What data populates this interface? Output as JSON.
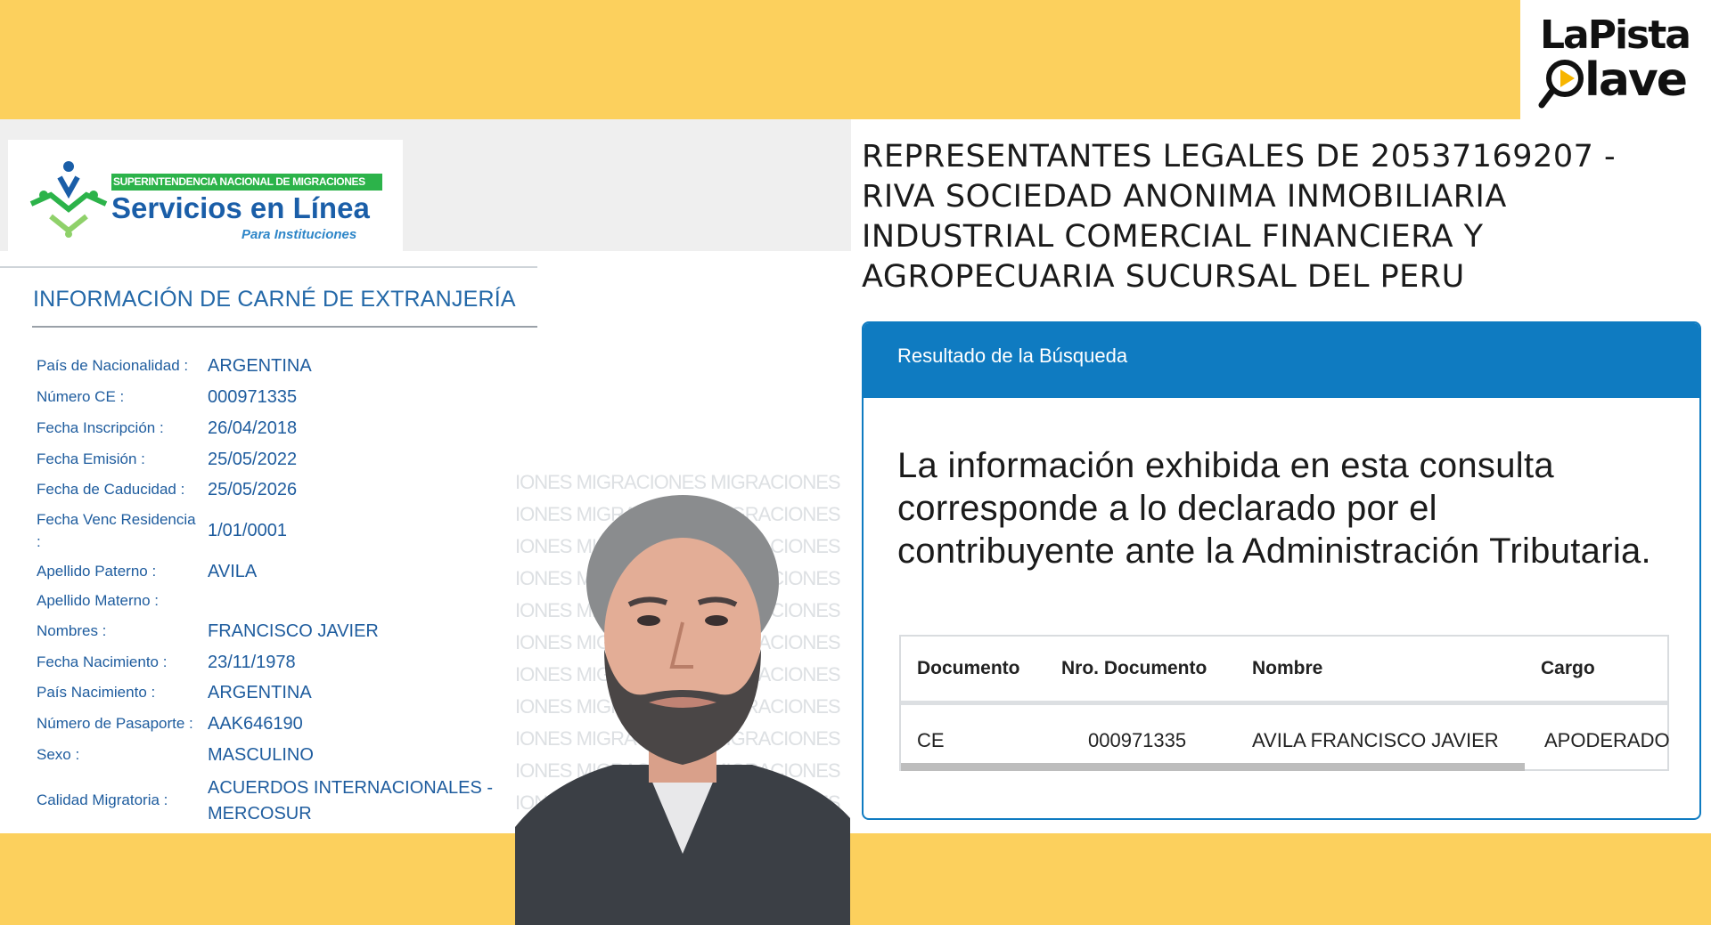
{
  "brand": {
    "line1": "LaPista",
    "line2": "lave"
  },
  "migraciones": {
    "strip": "SUPERINTENDENCIA NACIONAL DE MIGRACIONES",
    "title": "Servicios en Línea",
    "subtitle": "Para Instituciones",
    "section_title": "INFORMACIÓN DE CARNÉ DE EXTRANJERÍA",
    "watermark": "IONES MIGRACIONES MIGRACIONES",
    "fields": [
      {
        "label": "País de Nacionalidad :",
        "value": "ARGENTINA"
      },
      {
        "label": "Número CE :",
        "value": "000971335"
      },
      {
        "label": "Fecha Inscripción :",
        "value": "26/04/2018"
      },
      {
        "label": "Fecha Emisión :",
        "value": "25/05/2022"
      },
      {
        "label": "Fecha de Caducidad :",
        "value": "25/05/2026"
      },
      {
        "label": "Fecha Venc Residencia",
        "label2": ":",
        "value": "1/01/0001"
      },
      {
        "label": "Apellido Paterno :",
        "value": "AVILA"
      },
      {
        "label": "Apellido Materno :",
        "value": ""
      },
      {
        "label": "Nombres :",
        "value": "FRANCISCO JAVIER"
      },
      {
        "label": "Fecha Nacimiento :",
        "value": "23/11/1978"
      },
      {
        "label": "País Nacimiento :",
        "value": "ARGENTINA"
      },
      {
        "label": "Número de Pasaporte :",
        "value": "AAK646190"
      },
      {
        "label": "Sexo :",
        "value": "MASCULINO"
      },
      {
        "label": "Calidad Migratoria :",
        "value": "ACUERDOS INTERNACIONALES -",
        "value2": "MERCOSUR"
      }
    ]
  },
  "sunat": {
    "title": "REPRESENTANTES LEGALES DE 20537169207 - RIVA SOCIEDAD ANONIMA INMOBILIARIA INDUSTRIAL COMERCIAL FINANCIERA Y AGROPECUARIA SUCURSAL DEL PERU",
    "card_header": "Resultado de la Búsqueda",
    "notice": "La información exhibida en esta consulta corresponde a lo declarado por el contribuyente ante la Administración Tributaria.",
    "table": {
      "headers": [
        "Documento",
        "Nro. Documento",
        "Nombre",
        "Cargo"
      ],
      "rows": [
        [
          "CE",
          "000971335",
          "AVILA FRANCISCO JAVIER",
          "APODERADO"
        ]
      ]
    }
  },
  "colors": {
    "band": "#fcd05d",
    "accent_blue": "#0f7bc1",
    "migr_blue": "#1e5c9e",
    "migr_green": "#2cb34a"
  }
}
